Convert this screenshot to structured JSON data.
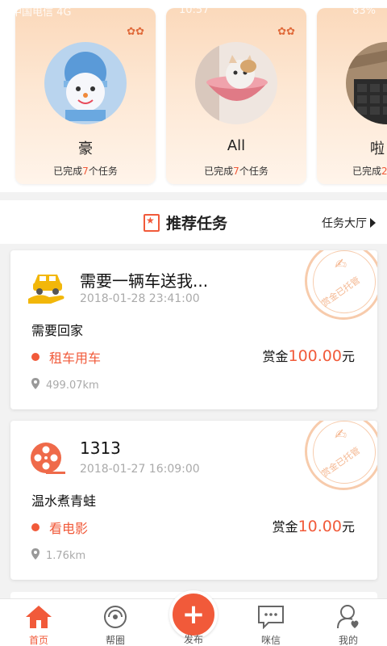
{
  "status_bar": {
    "carrier": "中国电信 4G",
    "time": "10:57",
    "battery": "83%"
  },
  "user_cards": [
    {
      "name": "豪",
      "done_prefix": "已完成",
      "done_count": "7",
      "done_suffix": "个任务",
      "avatar": "snowman-photo"
    },
    {
      "name": "All",
      "done_prefix": "已完成",
      "done_count": "7",
      "done_suffix": "个任务",
      "avatar": "cat-in-bowl-photo"
    },
    {
      "name": "啦",
      "done_prefix": "已完成",
      "done_count": "2",
      "done_suffix": "",
      "avatar": "keyboard-photo"
    }
  ],
  "section": {
    "title": "推荐任务",
    "link": "任务大厅"
  },
  "tasks": [
    {
      "icon": "car-hand-icon",
      "title": "需要一辆车送我...",
      "time": "2018-01-28 23:41:00",
      "desc": "需要回家",
      "category": "租车用车",
      "reward_label": "赏金",
      "reward_amount": "100.00",
      "reward_unit": "元",
      "distance": "499.07km",
      "stamp": "赏金已托管"
    },
    {
      "icon": "film-reel-icon",
      "title": "1313",
      "time": "2018-01-27 16:09:00",
      "desc": "温水煮青蛙",
      "category": "看电影",
      "reward_label": "赏金",
      "reward_amount": "10.00",
      "reward_unit": "元",
      "distance": "1.76km",
      "stamp": "赏金已托管"
    }
  ],
  "tabbar": {
    "home": "首页",
    "circle": "帮圈",
    "publish": "发布",
    "messages": "咪信",
    "mine": "我的"
  },
  "colors": {
    "accent": "#f15a3a",
    "card_gradient_top": "#fbd9bb"
  }
}
